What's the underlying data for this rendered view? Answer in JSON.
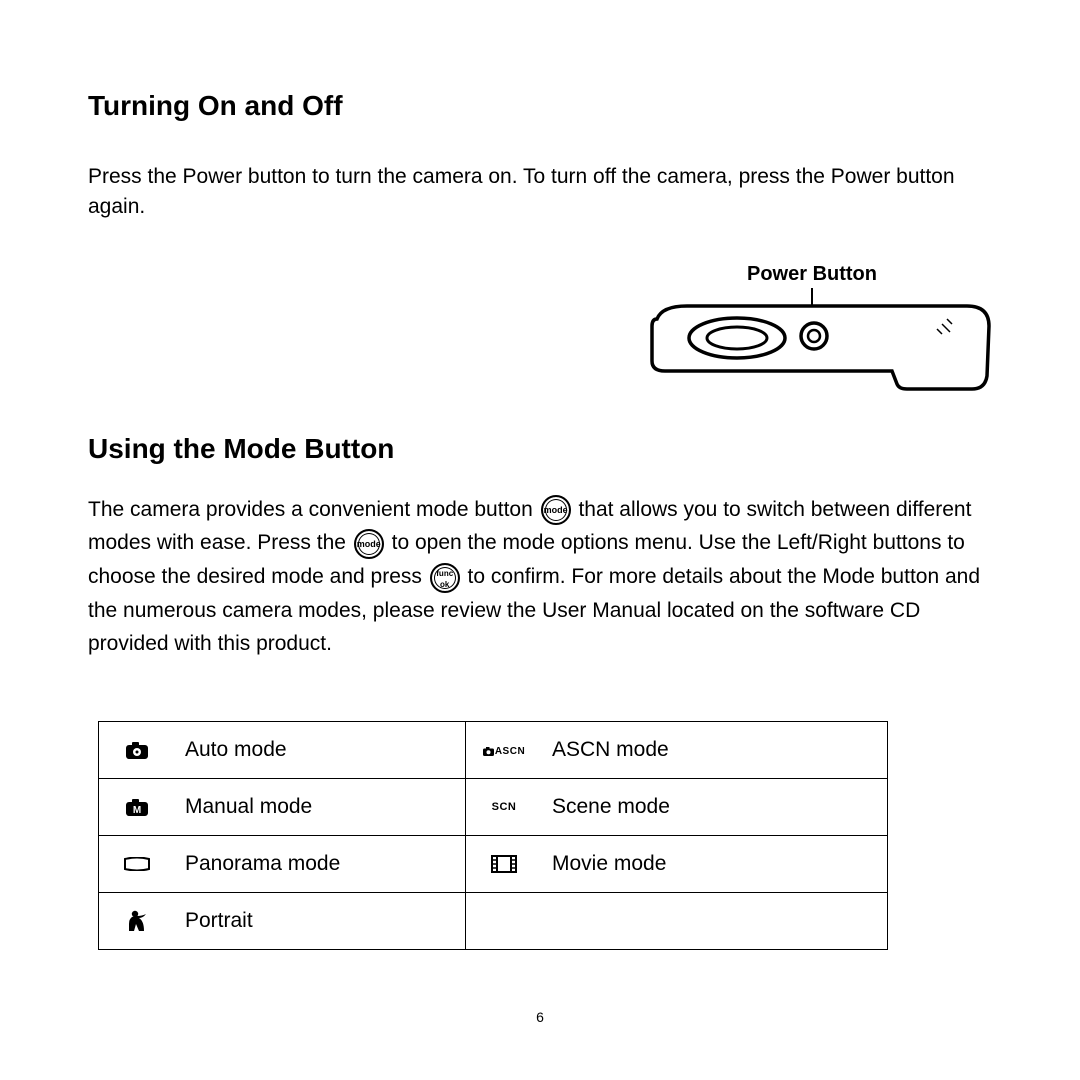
{
  "section1": {
    "heading": "Turning On and Off",
    "paragraph": "Press the Power button to turn the camera on. To turn off the camera, press the Power button again.",
    "power_label": "Power Button"
  },
  "section2": {
    "heading": "Using the Mode Button",
    "para_parts": {
      "p1": "The camera provides a convenient mode button ",
      "p2": " that allows you to switch between different modes with ease. Press the ",
      "p3": " to open the mode options menu. Use the Left/Right buttons to choose the desired mode and press ",
      "p4": " to confirm. For more details about the Mode button and the numerous camera modes, please review the User Manual located on the software CD provided with this product."
    },
    "buttons": {
      "mode": "mode",
      "func": "func\nok"
    }
  },
  "modes": {
    "left": [
      {
        "icon": "camera-auto",
        "label": "Auto mode"
      },
      {
        "icon": "camera-manual",
        "label": "Manual mode"
      },
      {
        "icon": "panorama",
        "label": "Panorama mode"
      },
      {
        "icon": "portrait",
        "label": "Portrait"
      }
    ],
    "right": [
      {
        "icon": "ascn",
        "icon_text": "ASCN",
        "label": "ASCN mode"
      },
      {
        "icon": "scn",
        "icon_text": "SCN",
        "label": "Scene mode"
      },
      {
        "icon": "movie",
        "label": "Movie mode"
      }
    ]
  },
  "page_number": "6"
}
